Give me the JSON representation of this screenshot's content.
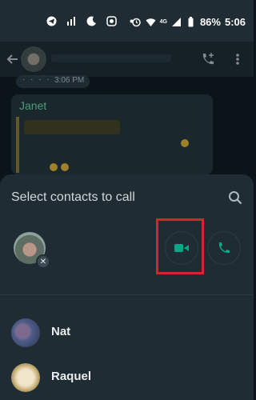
{
  "status_bar": {
    "battery": "86%",
    "time": "5:06",
    "network": "4G"
  },
  "background_chat": {
    "time_chip": "3:06 PM",
    "sender_name": "Janet"
  },
  "call_sheet": {
    "title": "Select contacts to call",
    "contacts": [
      {
        "name": "Nat"
      },
      {
        "name": "Raquel"
      }
    ]
  },
  "colors": {
    "accent_green": "#00a884",
    "highlight_red": "#d8242c",
    "sheet_bg": "#1f2c33"
  }
}
